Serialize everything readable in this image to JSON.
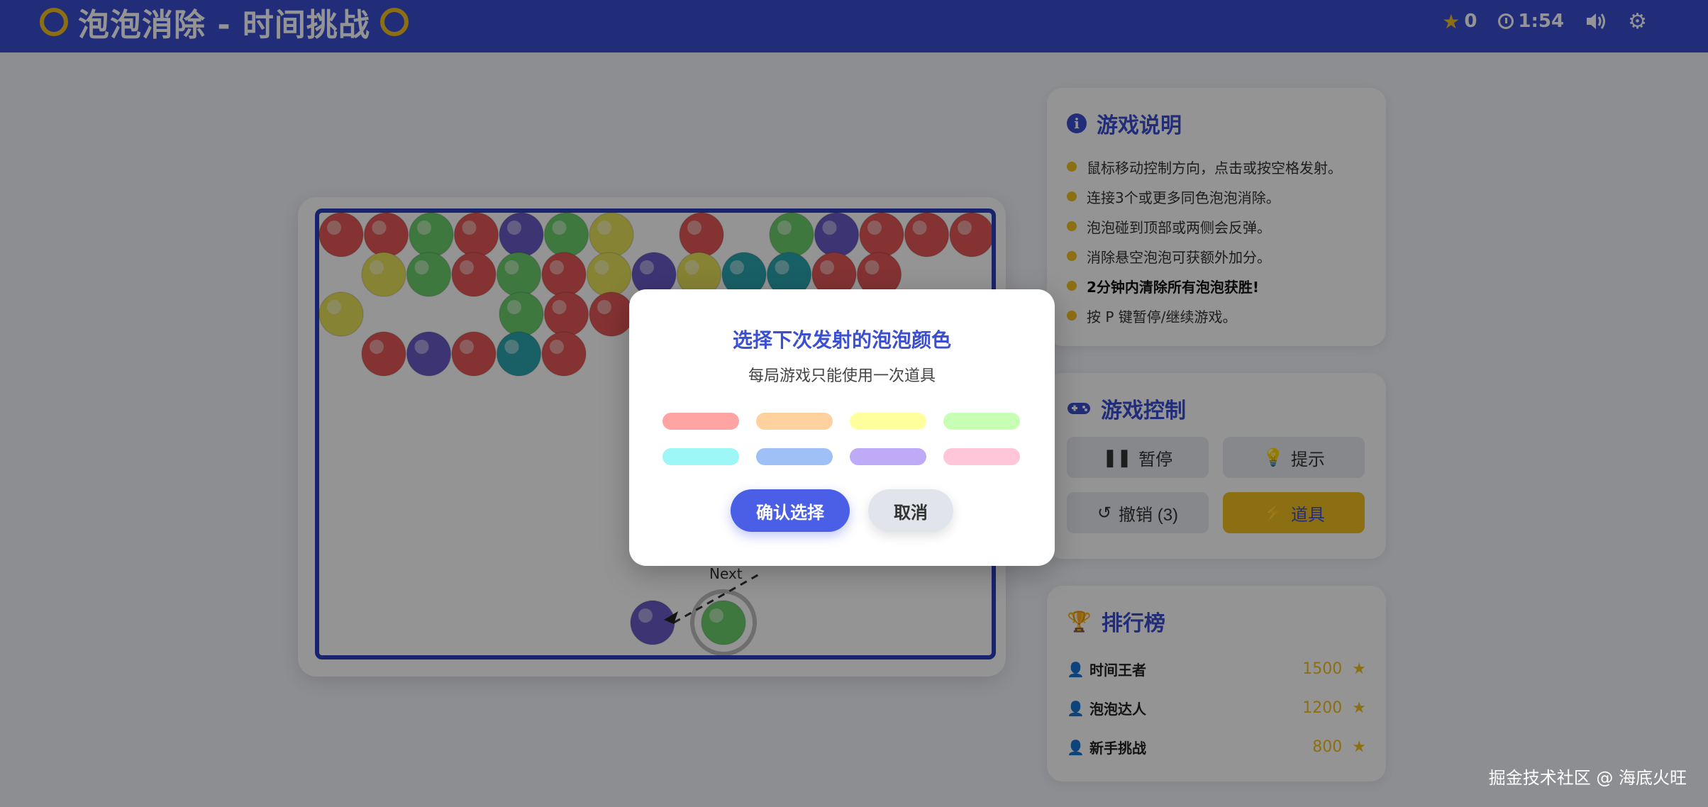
{
  "header": {
    "title": "泡泡消除 - 时间挑战",
    "score": "0",
    "timer": "1:54",
    "icons": [
      "star-icon",
      "clock-icon",
      "volume-icon",
      "gear-icon"
    ]
  },
  "colors": {
    "header": "#3b4fd1",
    "accent": "#3b4fd1",
    "gold": "#f2c021",
    "board_border": "#2c3fc0"
  },
  "board": {
    "next_label": "Next",
    "bubble_rows": [
      [
        "red",
        "red",
        "green",
        "red",
        "purple",
        "green",
        "yellow",
        "empty",
        "red",
        "empty",
        "green",
        "purple",
        "red",
        "red",
        "red"
      ],
      [
        "yellow",
        "green",
        "red",
        "green",
        "red",
        "yellow",
        "purple",
        "yellow",
        "teal",
        "teal",
        "red",
        "red"
      ],
      [
        "yellow",
        "empty",
        "empty",
        "empty",
        "green",
        "red",
        "red"
      ],
      [
        "red",
        "purple",
        "red",
        "teal",
        "red"
      ]
    ],
    "current_bubble": "purple",
    "next_bubble": "green"
  },
  "instructions": {
    "title": "游戏说明",
    "items": [
      {
        "text": "鼠标移动控制方向，点击或按空格发射。",
        "bold": false
      },
      {
        "text": "连接3个或更多同色泡泡消除。",
        "bold": false
      },
      {
        "text": "泡泡碰到顶部或两侧会反弹。",
        "bold": false
      },
      {
        "text": "消除悬空泡泡可获额外加分。",
        "bold": false
      },
      {
        "text": "2分钟内清除所有泡泡获胜!",
        "bold": true
      },
      {
        "text": "按 P 键暂停/继续游戏。",
        "bold": false
      }
    ]
  },
  "controls": {
    "title": "游戏控制",
    "pause": "暂停",
    "hint": "提示",
    "undo": "撤销 (3)",
    "tool": "道具"
  },
  "leaderboard": {
    "title": "排行榜",
    "entries": [
      {
        "name": "时间王者",
        "score": "1500"
      },
      {
        "name": "泡泡达人",
        "score": "1200"
      },
      {
        "name": "新手挑战",
        "score": "800"
      }
    ]
  },
  "modal": {
    "title": "选择下次发射的泡泡颜色",
    "subtitle": "每局游戏只能使用一次道具",
    "swatches": [
      "#ffa3a3",
      "#ffd19e",
      "#ffff9e",
      "#c7ffb5",
      "#9ef7f7",
      "#9ec0f7",
      "#bfaaf7",
      "#ffc5d9"
    ],
    "confirm": "确认选择",
    "cancel": "取消"
  },
  "watermark": "掘金技术社区 @ 海底火旺"
}
